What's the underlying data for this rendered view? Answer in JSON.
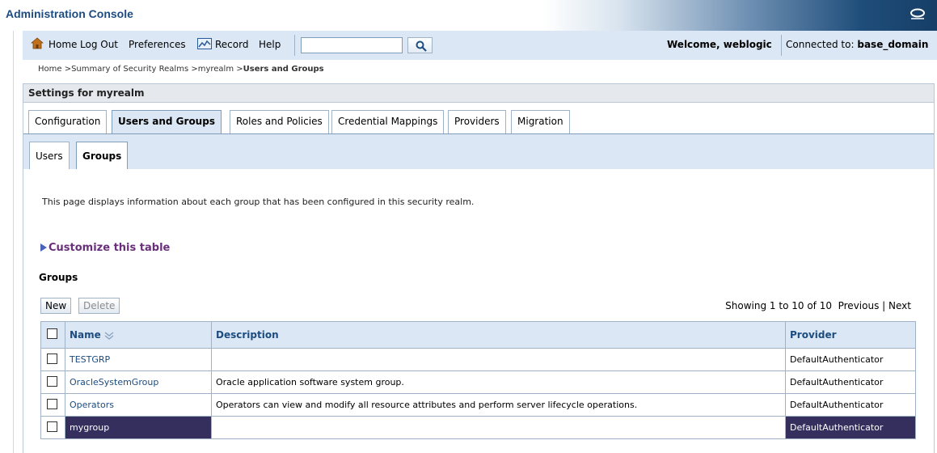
{
  "app": {
    "title": "Administration Console",
    "logo_icon": "oracle-logo-icon"
  },
  "toolbar": {
    "home": "Home",
    "logout": "Log Out",
    "preferences": "Preferences",
    "record": "Record",
    "help": "Help",
    "search_value": "",
    "welcome": "Welcome, weblogic",
    "connected_prefix": "Connected to:",
    "domain": "base_domain"
  },
  "breadcrumb": {
    "path": "Home >Summary of Security Realms >myrealm >",
    "current": "Users and Groups"
  },
  "panel": {
    "title": "Settings for myrealm"
  },
  "tabs": [
    {
      "label": "Configuration",
      "active": false
    },
    {
      "label": "Users and Groups",
      "active": true
    },
    {
      "label": "Roles and Policies",
      "active": false
    },
    {
      "label": "Credential Mappings",
      "active": false
    },
    {
      "label": "Providers",
      "active": false
    },
    {
      "label": "Migration",
      "active": false
    }
  ],
  "subtabs": [
    {
      "label": "Users",
      "active": false
    },
    {
      "label": "Groups",
      "active": true
    }
  ],
  "description": "This page displays information about each group that has been configured in this security realm.",
  "customize": "Customize this table",
  "groups_table": {
    "title": "Groups",
    "new_button": "New",
    "delete_button": "Delete",
    "paging": {
      "showing": "Showing 1 to 10 of 10",
      "previous": "Previous",
      "separator": "|",
      "next": "Next"
    },
    "columns": {
      "name": "Name",
      "description": "Description",
      "provider": "Provider"
    },
    "rows": [
      {
        "name": "TESTGRP",
        "description": "",
        "provider": "DefaultAuthenticator"
      },
      {
        "name": "OracleSystemGroup",
        "description": "Oracle application software system group.",
        "provider": "DefaultAuthenticator"
      },
      {
        "name": "Operators",
        "description": "Operators can view and modify all resource attributes and perform server lifecycle operations.",
        "provider": "DefaultAuthenticator"
      },
      {
        "name": "mygroup",
        "description": "",
        "provider": "DefaultAuthenticator",
        "selected": true
      }
    ]
  },
  "colors": {
    "accent": "#1c4c80",
    "toolbar_bg": "#dbe7f4",
    "selection": "#352f5e"
  }
}
